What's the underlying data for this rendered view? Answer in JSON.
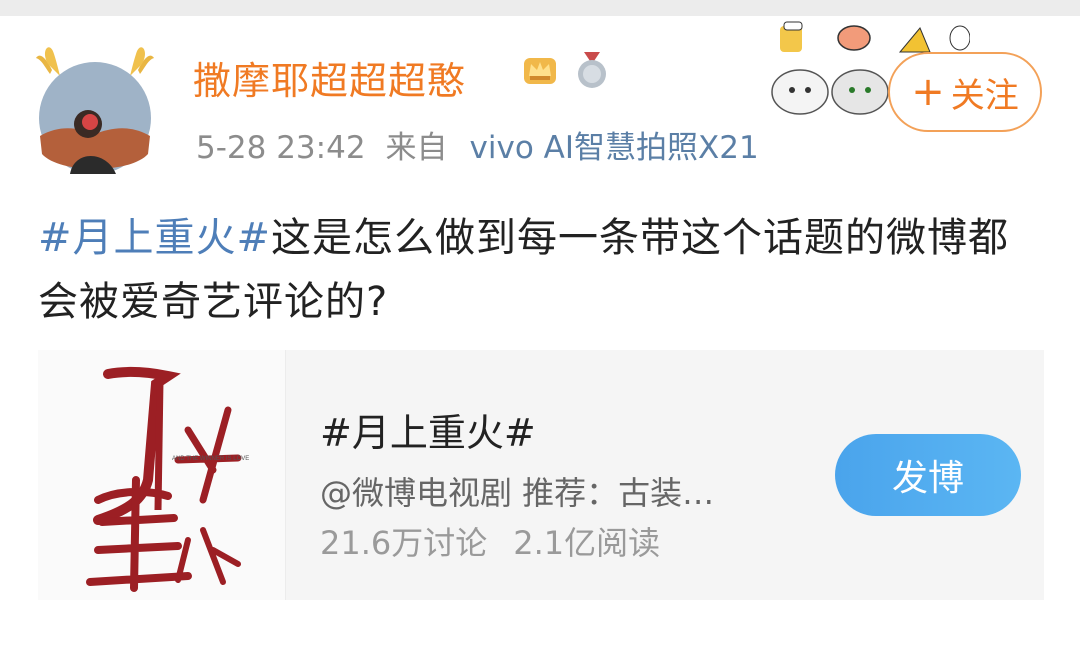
{
  "post": {
    "username": "撒摩耶超超超憨",
    "timestamp": "5-28 23:42",
    "from_label": "来自",
    "source": "vivo AI智慧拍照X21",
    "follow_label": "关注",
    "text_topic": "#月上重火#",
    "text_body": "这是怎么做到每一条带这个话题的微博都会被爱奇艺评论的?"
  },
  "topic_card": {
    "title": "#月上重火#",
    "subtitle": "@微博电视剧 推荐：古装…",
    "discussions": "21.6万讨论",
    "reads": "2.1亿阅读",
    "post_button": "发博",
    "poster_text": "AND THE WINNER IS LOVE"
  },
  "colors": {
    "username": "#f07a23",
    "topic_link": "#4e7eb8",
    "post_button": "#4aa4ec",
    "follow_border": "#f3a158"
  },
  "icons": [
    "avatar-deer-antlers",
    "crown-badge-icon",
    "medal-badge-icon",
    "sticker-decoration",
    "plus-icon"
  ]
}
